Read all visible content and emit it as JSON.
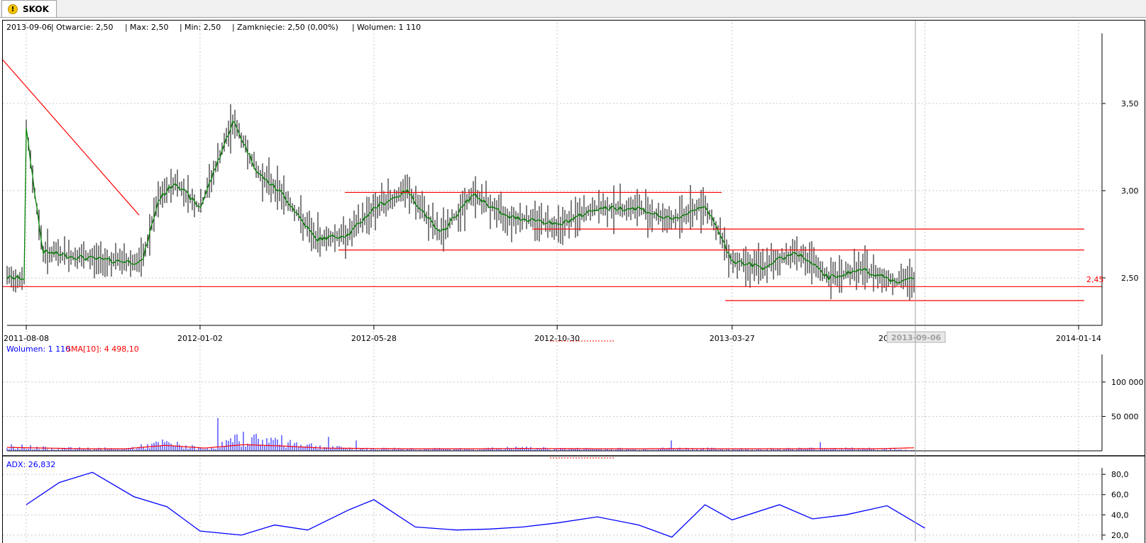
{
  "tab": {
    "title": "SKOK",
    "icon": "warning-icon"
  },
  "header": {
    "date": "2013-09-06",
    "open": "Otwarcie: 2,50",
    "max": "Max: 2,50",
    "min": "Min: 2,50",
    "close": "Zamknięcie: 2,50 (0,00%)",
    "volume": "Wolumen: 1 110"
  },
  "x_axis": {
    "ticks": [
      "2011-08-08",
      "2012-01-02",
      "2012-05-28",
      "2012-10-30",
      "2013-03-27",
      "2014-01-14"
    ],
    "cursor_label": "2013-09-06",
    "cursor_partial": "20"
  },
  "price_panel": {
    "y_ticks": [
      "3,50",
      "3,00",
      "2,50"
    ],
    "marker_label": "2,45"
  },
  "volume_panel": {
    "label_volume": "Wolumen: 1 110",
    "label_sma": "SMA[10]: 4 498,10",
    "y_ticks": [
      "100 000",
      "50 000"
    ]
  },
  "adx_panel": {
    "label": "ADX: 26,832",
    "y_ticks": [
      "80,0",
      "60,0",
      "40,0",
      "20,0"
    ]
  },
  "colors": {
    "candles": "#000000",
    "price_ma": "#008000",
    "trend_lines": "#ff0000",
    "volume_bars": "#0000ff",
    "volume_sma": "#ff0000",
    "adx": "#0000ff",
    "grid": "#c8c8c8"
  },
  "chart_data": [
    {
      "type": "line",
      "title": "SKOK",
      "series": [
        {
          "name": "ADX",
          "x": [
            "2011-08-08",
            "2011-09-05",
            "2011-10-03",
            "2011-11-07",
            "2011-12-05",
            "2012-01-02",
            "2012-02-06",
            "2012-03-05",
            "2012-04-02",
            "2012-05-07",
            "2012-05-28",
            "2012-07-02",
            "2012-08-06",
            "2012-09-03",
            "2012-10-01",
            "2012-10-30",
            "2012-12-03",
            "2013-01-07",
            "2013-02-04",
            "2013-03-04",
            "2013-03-27",
            "2013-05-06",
            "2013-06-03",
            "2013-07-01",
            "2013-08-05",
            "2013-09-06"
          ],
          "values": [
            50,
            72,
            82,
            58,
            48,
            24,
            20,
            30,
            25,
            45,
            55,
            28,
            25,
            26,
            28,
            32,
            38,
            30,
            18,
            50,
            35,
            50,
            36,
            40,
            49,
            26.832
          ]
        }
      ],
      "ylim": [
        15,
        85
      ]
    },
    {
      "type": "line",
      "title": "SKOK",
      "series": [
        {
          "name": "Zamknięcie",
          "x": [
            "2011-08-08",
            "2011-08-22",
            "2011-09-19",
            "2011-10-17",
            "2011-11-14",
            "2011-11-28",
            "2011-12-12",
            "2012-01-02",
            "2012-01-30",
            "2012-02-20",
            "2012-03-12",
            "2012-04-09",
            "2012-05-07",
            "2012-05-28",
            "2012-06-25",
            "2012-07-23",
            "2012-08-20",
            "2012-09-17",
            "2012-10-15",
            "2012-10-30",
            "2012-12-03",
            "2013-01-07",
            "2013-02-04",
            "2013-03-04",
            "2013-03-27",
            "2013-04-22",
            "2013-05-20",
            "2013-06-17",
            "2013-07-15",
            "2013-08-12",
            "2013-09-06"
          ],
          "values": [
            3.35,
            2.65,
            2.62,
            2.6,
            2.59,
            2.95,
            3.05,
            2.9,
            3.4,
            3.1,
            2.98,
            2.72,
            2.75,
            2.9,
            3.0,
            2.75,
            2.98,
            2.85,
            2.83,
            2.8,
            2.9,
            2.9,
            2.83,
            2.92,
            2.6,
            2.56,
            2.65,
            2.5,
            2.55,
            2.48,
            2.5
          ]
        }
      ],
      "ylim": [
        2.25,
        3.9
      ]
    },
    {
      "type": "bar",
      "series": [
        {
          "name": "Wolumen",
          "values": [
            8000,
            4000,
            3500,
            3000,
            12000,
            2800,
            20000,
            15000,
            6000,
            3000,
            3500,
            2800,
            3000,
            4500,
            3000,
            3200,
            3000,
            3500,
            3000,
            2800,
            3300,
            3500,
            3000,
            1110
          ]
        },
        {
          "name": "SMA[10]",
          "values": [
            5000,
            4000,
            3000,
            3000,
            8000,
            4000,
            9000,
            7000,
            4000,
            3500,
            3000,
            3000,
            3000,
            3500,
            3200,
            3000,
            3000,
            3200,
            3000,
            3000,
            3000,
            3200,
            3000,
            4498.1
          ]
        }
      ],
      "ylim": [
        0,
        140000
      ]
    }
  ]
}
